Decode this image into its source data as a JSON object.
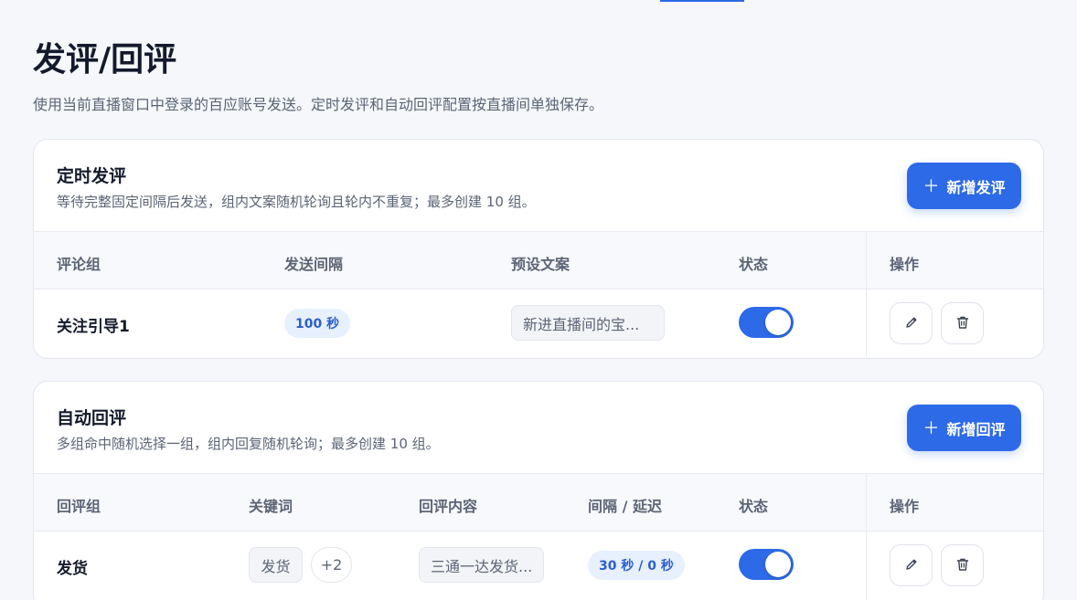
{
  "page": {
    "title": "发评/回评",
    "description": "使用当前直播窗口中登录的百应账号发送。定时发评和自动回评配置按直播间单独保存。"
  },
  "scheduled": {
    "title": "定时发评",
    "subtitle": "等待完整固定间隔后发送，组内文案随机轮询且轮内不重复；最多创建 10 组。",
    "add_button": "新增发评",
    "add_icon": "plus-icon",
    "columns": [
      "评论组",
      "发送间隔",
      "预设文案",
      "状态",
      "操作"
    ],
    "rows": [
      {
        "group": "关注引导1",
        "interval": "100 秒",
        "preset_text": "新进直播间的宝...",
        "enabled": true
      }
    ]
  },
  "auto_reply": {
    "title": "自动回评",
    "subtitle": "多组命中随机选择一组，组内回复随机轮询；最多创建 10 组。",
    "add_button": "新增回评",
    "add_icon": "plus-icon",
    "columns": [
      "回评组",
      "关键词",
      "回评内容",
      "间隔 / 延迟",
      "状态",
      "操作"
    ],
    "rows": [
      {
        "group": "发货",
        "keyword": "发货",
        "keyword_more": "+2",
        "content": "三通一达发货...",
        "interval_delay": "30 秒 / 0 秒",
        "enabled": true
      }
    ]
  },
  "icons": {
    "edit": "pencil-icon",
    "delete": "trash-icon"
  },
  "colors": {
    "accent": "#2d6ae8",
    "pill_bg": "#e7f0ff",
    "pill_text": "#2a5fcf"
  }
}
